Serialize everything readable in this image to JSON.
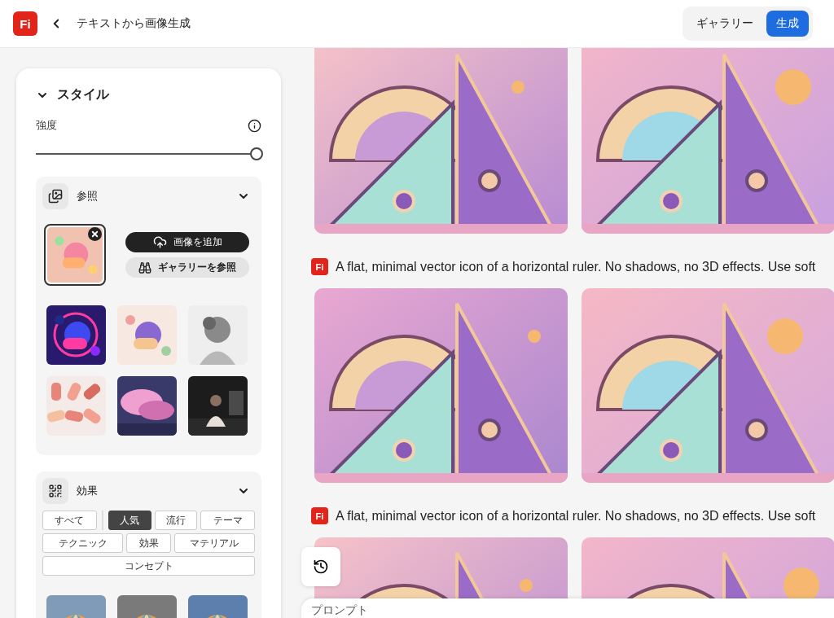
{
  "header": {
    "logo": "Fi",
    "title": "テキストから画像生成",
    "nav": [
      {
        "label": "ギャラリー",
        "selected": false
      },
      {
        "label": "生成",
        "selected": true
      }
    ]
  },
  "style_panel": {
    "title": "スタイル",
    "expanded": true,
    "strength": {
      "label": "強度",
      "level": 1
    },
    "reference": {
      "title": "参照",
      "expanded": true,
      "selected_image": {
        "kind": "picture"
      },
      "buttons": [
        {
          "label": "画像を追加",
          "kind": "primary"
        },
        {
          "label": "ギャラリーを参照",
          "kind": "secondary"
        }
      ],
      "thumbnails": [
        {
          "kind": "picture"
        },
        {
          "kind": "picture"
        },
        {
          "kind": "picture"
        },
        {
          "kind": "picture"
        },
        {
          "kind": "picture"
        },
        {
          "kind": "picture"
        }
      ]
    },
    "effects": {
      "title": "効果",
      "expanded": true,
      "filter_rows": [
        [
          {
            "label": "すべて",
            "selected": false
          },
          {
            "label": "人気",
            "selected": true
          },
          {
            "label": "流行",
            "selected": false
          },
          {
            "label": "テーマ",
            "selected": false
          }
        ],
        [
          {
            "label": "テクニック",
            "selected": false
          },
          {
            "label": "効果",
            "selected": false
          },
          {
            "label": "マテリアル",
            "selected": false
          }
        ],
        [
          {
            "label": "コンセプト",
            "selected": false
          }
        ]
      ],
      "thumbnails": [
        {
          "kind": "picture"
        },
        {
          "kind": "picture"
        },
        {
          "kind": "picture"
        }
      ]
    }
  },
  "results": [
    {
      "images": [
        {
          "kind": "picture"
        },
        {
          "kind": "picture"
        }
      ]
    },
    {
      "badge": "Fi",
      "caption": "A flat, minimal vector icon of a horizontal ruler. No shadows, no 3D effects. Use soft",
      "images": [
        {
          "kind": "picture"
        },
        {
          "kind": "picture"
        }
      ]
    },
    {
      "badge": "Fi",
      "caption": "A flat, minimal vector icon of a horizontal ruler. No shadows, no 3D effects. Use soft",
      "images": [
        {
          "kind": "picture"
        },
        {
          "kind": "picture"
        }
      ]
    }
  ],
  "prompt": {
    "label": "プロンプト"
  }
}
